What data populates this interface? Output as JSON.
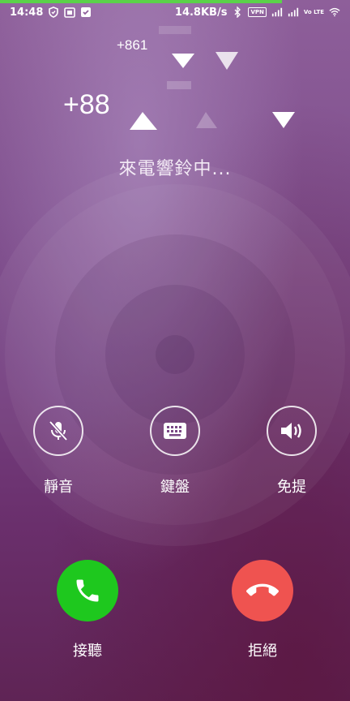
{
  "status_bar": {
    "time": "14:48",
    "network_speed": "14.8KB/s",
    "vpn_label": "VPN",
    "volte_label": "Vo LTE",
    "icons": [
      "shield-icon",
      "screenshot-icon",
      "clipboard-check-icon",
      "bluetooth-icon",
      "signal-icon",
      "wifi-icon"
    ]
  },
  "caller": {
    "number_small": "+861",
    "number_large": "+88"
  },
  "call_status": "來電響鈴中...",
  "actions": [
    {
      "id": "mute",
      "label": "靜音",
      "icon": "mic-off-icon"
    },
    {
      "id": "keypad",
      "label": "鍵盤",
      "icon": "keypad-icon"
    },
    {
      "id": "speaker",
      "label": "免提",
      "icon": "speaker-icon"
    }
  ],
  "answer": {
    "label": "接聽",
    "color": "#1ec81e",
    "icon": "phone-answer-icon"
  },
  "decline": {
    "label": "拒絕",
    "color": "#ef5350",
    "icon": "phone-hangup-icon"
  }
}
